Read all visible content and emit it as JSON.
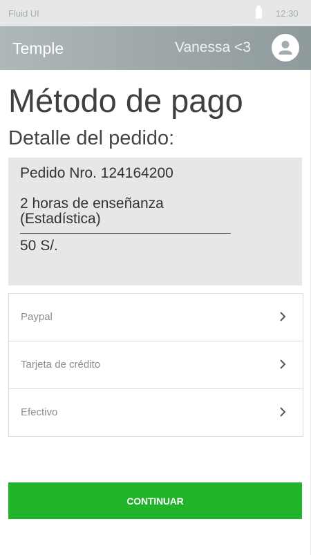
{
  "status_bar": {
    "app_name": "Fluid UI",
    "time": "12:30",
    "battery_icon": "battery-icon"
  },
  "app_bar": {
    "title": "Temple",
    "user_name": "Vanessa <3",
    "avatar_icon": "user-avatar-icon"
  },
  "page": {
    "title": "Método de pago",
    "section_title": "Detalle del pedido:"
  },
  "order": {
    "number": "Pedido Nro. 124164200",
    "item_line1": "2 horas de enseñanza",
    "item_line2": "(Estadística)",
    "divider": "____________________________",
    "price": "50 S/."
  },
  "payment_methods": [
    {
      "label": "Paypal",
      "icon": "chevron-right-icon"
    },
    {
      "label": "Tarjeta de crédito",
      "icon": "chevron-right-icon"
    },
    {
      "label": "Efectivo",
      "icon": "chevron-right-icon"
    }
  ],
  "actions": {
    "continue_label": "CONTINUAR"
  },
  "colors": {
    "status_bar_bg": "#e6e7e8",
    "app_bar_bg": "#9aa4a7",
    "order_box_bg": "#e7e7e9",
    "accent_green": "#21b42b"
  }
}
